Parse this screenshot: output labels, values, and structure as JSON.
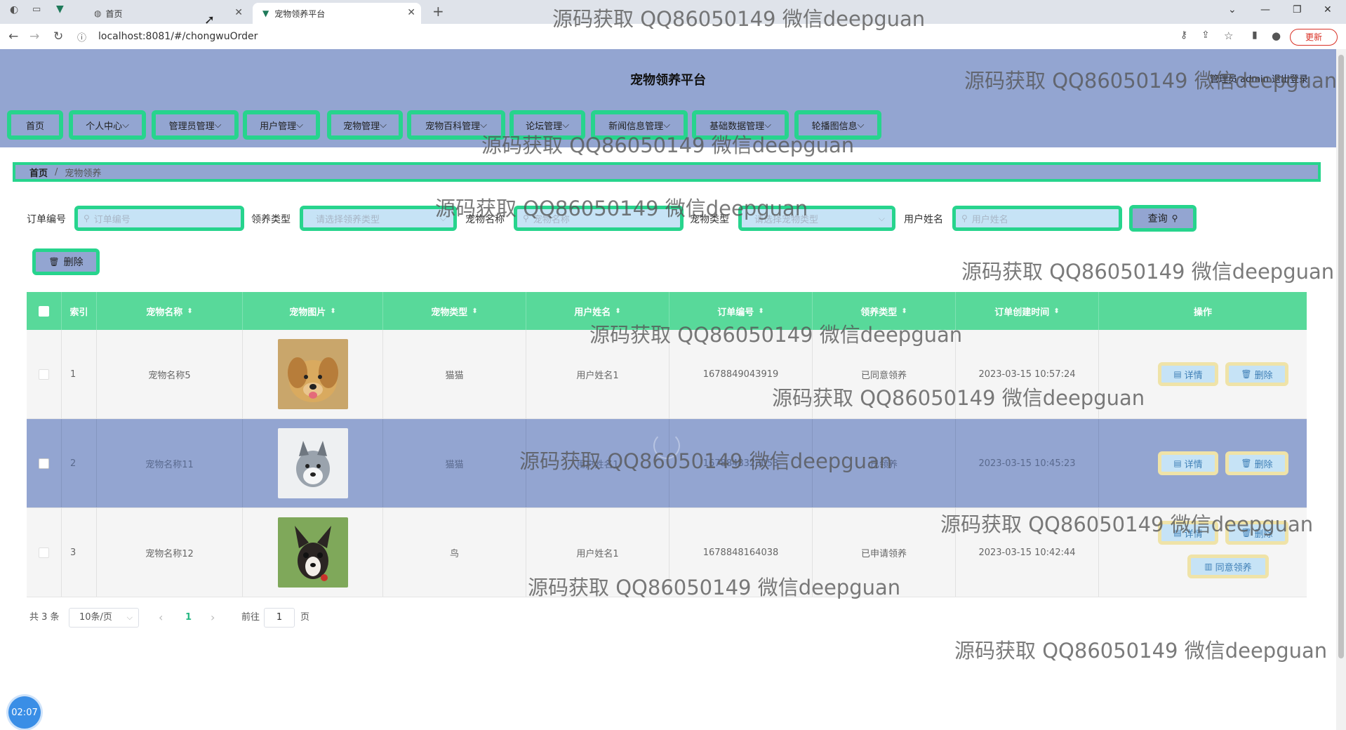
{
  "browser": {
    "tabs": [
      {
        "label": "首页",
        "active": false
      },
      {
        "label": "宠物领养平台",
        "active": true
      }
    ],
    "new_tab": "+",
    "url": "localhost:8081/#/chongwuOrder",
    "update_label": "更新"
  },
  "app": {
    "title": "宠物领养平台",
    "header_right": "管理员 admin   退出登录",
    "menu": [
      "首页",
      "个人中心",
      "管理员管理",
      "用户管理",
      "宠物管理",
      "宠物百科管理",
      "论坛管理",
      "新闻信息管理",
      "基础数据管理",
      "轮播图信息"
    ],
    "breadcrumb": {
      "home": "首页",
      "separator": "/",
      "current": "宠物领养"
    }
  },
  "search": {
    "fields": [
      {
        "label": "订单编号",
        "placeholder": "订单编号"
      },
      {
        "label": "领养类型",
        "placeholder": "请选择领养类型"
      },
      {
        "label": "宠物名称",
        "placeholder": "宠物名称"
      },
      {
        "label": "宠物类型",
        "placeholder": "请选择宠物类型"
      },
      {
        "label": "用户姓名",
        "placeholder": "用户姓名"
      }
    ],
    "button_label": "查询"
  },
  "toolbar": {
    "delete_label": "删除"
  },
  "table": {
    "headers": [
      "索引",
      "宠物名称",
      "宠物图片",
      "宠物类型",
      "用户姓名",
      "订单编号",
      "领养类型",
      "订单创建时间",
      "操作"
    ],
    "rows": [
      {
        "index": "1",
        "pet_name": "宠物名称5",
        "pet_type": "猫猫",
        "user_name": "用户姓名1",
        "order_no": "1678849043919",
        "adopt_type": "已同意领养",
        "created": "2023-03-15 10:57:24",
        "image": "dog-golden"
      },
      {
        "index": "2",
        "pet_name": "宠物名称11",
        "pet_type": "猫猫",
        "user_name": "用户姓名1",
        "order_no": "1678848323053",
        "adopt_type": "已领养",
        "created": "2023-03-15 10:45:23",
        "image": "dog-husky"
      },
      {
        "index": "3",
        "pet_name": "宠物名称12",
        "pet_type": "鸟",
        "user_name": "用户姓名1",
        "order_no": "1678848164038",
        "adopt_type": "已申请领养",
        "created": "2023-03-15 10:42:44",
        "image": "dog-chihuahua"
      }
    ],
    "ops": {
      "detail": "详情",
      "delete": "删除",
      "agree": "同意领养"
    }
  },
  "pager": {
    "total": "共 3 条",
    "page_size": "10条/页",
    "prev": "‹",
    "current": "1",
    "next": "›",
    "goto_prefix": "前往",
    "goto_value": "1",
    "goto_suffix": "页"
  },
  "timer": "02:07",
  "watermark": "源码获取 QQ86050149 微信deepguan",
  "colors": {
    "header_bg": "#93a5d1",
    "highlight_border": "#27d48d",
    "table_head": "#58d99a",
    "input_bg": "#c6e3f6"
  }
}
